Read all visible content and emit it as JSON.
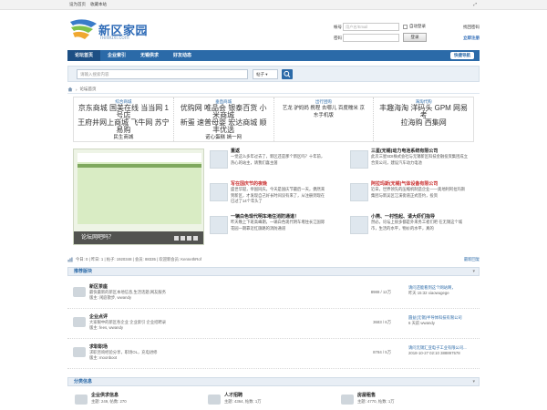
{
  "topbar": {
    "set_home": "设为首页",
    "bookmark": "收藏本站",
    "expand": "⤢"
  },
  "logo": {
    "cn": "新区家园",
    "en": "newuxi.com"
  },
  "login": {
    "account_label": "帐号",
    "account_placeholder": "用户名/Email",
    "auto_login": "自动登录",
    "find_password": "找回密码",
    "password_label": "密码",
    "login_button": "登录",
    "register": "立即注册"
  },
  "nav": {
    "items": [
      "论坛首页",
      "企业索引",
      "无锡供求",
      "好友动态"
    ],
    "quick": "快捷导航"
  },
  "search": {
    "placeholder": "请输入搜索内容",
    "type": "帖子"
  },
  "breadcrumb": {
    "home_icon": "home-icon",
    "sep": "›",
    "current": "论坛首页"
  },
  "links": [
    {
      "title": "综合商城",
      "lines": [
        "京东商城 国美在线 当当网 1号店",
        "王府井网上商城 飞牛网 苏宁易购",
        "民生商城"
      ]
    },
    {
      "title": "垂直商城",
      "lines": [
        "优购网 唯品会 银泰百货 小米商城",
        "新蛋 速普母婴 宏达商城 顺丰优选",
        "诺心蛋糕 嫣一网"
      ]
    },
    {
      "title": "出行团购",
      "lines": [
        "艺龙 驴妈妈 携程 去哪儿 百度糯米 京",
        "东手机版"
      ]
    },
    {
      "title": "海淘代购",
      "lines": [
        "丰趣海淘 洋码头 GPM 网易考",
        "拉海购 西集网"
      ]
    }
  ],
  "slide": {
    "caption": "论坛网吧吗？",
    "dots": 4
  },
  "news_left": [
    {
      "title": "重返",
      "text": "一觉这么多年过去了，新区还是那个新区吗？十年前，热心的站主，请我们喜主菌",
      "red": false
    },
    {
      "title": "写在国庆节的夜晚",
      "text": "盛世华诞，举国同庆。今天是国庆节最后一天，偶然来到新区，才发现自己好长时间没有来了，从注册到现在已过了14个年头了",
      "red": true
    },
    {
      "title": "一辆白色现代明车堵住消防通道！",
      "text": "昨天晚上下班高峰期，一辆白色现代明车堵住长江国际花园一期靠近红旗路的消防通道",
      "red": false
    }
  ],
  "news_right": [
    {
      "title": "三星(无锡)动力电池系统有限公司",
      "text": "此次三星SDI株式会社与无锡新区科技金融投资集团成立合资公司，建设汽车动力电池",
      "red": false
    },
    {
      "title": "阿拉玛斯(无锡)气体设备有限公司",
      "text": "近日，世界领先的压缩机制造企业——奥地利阿拉玛斯集团与新吴区江溪街道正式签约，投资",
      "red": true
    },
    {
      "title": "小燕、一村性起、请大虾们指导",
      "text": "然必。论坛上很多都是外来务工者们吧 在无锡这个城市，生活的水平，物价的水平，真的",
      "red": false
    }
  ],
  "stats": {
    "text": "今日: 0 | 昨日: 1 | 帖子: 1920348 | 会员: 88335 | 欢迎新会员: KennethRof",
    "latest": "最新回复"
  },
  "sections": {
    "recommended": "推荐版块",
    "categories": "分类信息",
    "collapse": "▾"
  },
  "forums": [
    {
      "name": "新区茶座",
      "desc": "最快最新的新区本地信息,生活话题,网友服务",
      "mods": "版主: 闲庭散步, wwandy",
      "count": "8988 / 12万",
      "last_title": "请问还能看到这个网站啊，",
      "last_meta": "昨天 15:32 xiaowugege"
    },
    {
      "name": "企业点评",
      "desc": "大家眼中的新区各企业 企业索引 企业招聘录",
      "mods": "版主: fees, wwandy",
      "count": "3683 / 6万",
      "last_title": "圆益(无锡)半导体科技有限公司",
      "last_meta": "6 天前 wwandy"
    },
    {
      "name": "求职职场",
      "desc": "求职咨询经验分享，职场OL，充电进修",
      "mods": "版主: moonboot",
      "count": "8784 / 5万",
      "last_title": "请问无锡汇亚电子工业有限公司...",
      "last_meta": "2018-10-27 02:10 388897578"
    }
  ],
  "categories": [
    {
      "name": "企业供求信息",
      "stat": "主题: 249, 帖数: 270"
    },
    {
      "name": "人才招聘",
      "stat": "主题: 4364, 帖数: 1万"
    },
    {
      "name": "房屋租售",
      "stat": "主题: 4770, 帖数: 1万"
    }
  ],
  "colors": {
    "nav": "#2b6aa8",
    "accent": "#2e6bb7",
    "highlight": "#c82b2b"
  }
}
